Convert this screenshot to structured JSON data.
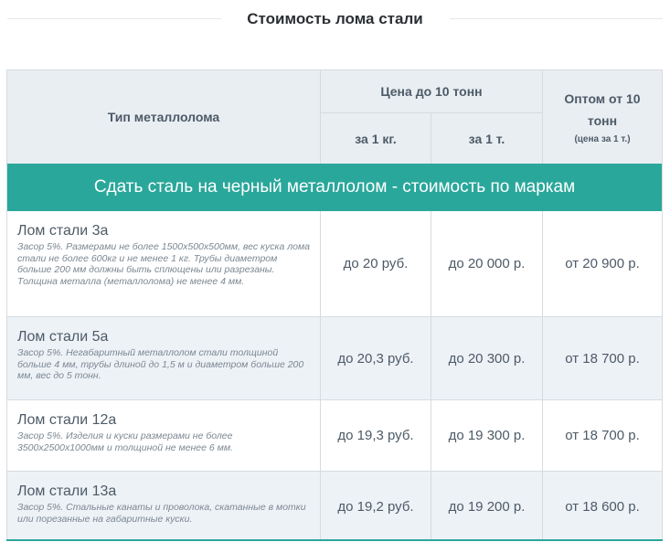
{
  "section": {
    "title": "Стоимость лома стали"
  },
  "table": {
    "header": {
      "type_label": "Тип металлолома",
      "price_group_label": "Цена до 10 тонн",
      "per_kg_label": "за 1 кг.",
      "per_ton_label": "за 1 т.",
      "wholesale_label": "Оптом от 10 тонн",
      "wholesale_sub": "(цена за 1 т.)"
    },
    "banner": "Сдать сталь на черный металлолом - стоимость по маркам",
    "rows": [
      {
        "name": "Лом стали 3а",
        "desc": "Засор 5%. Размерами не более 1500х500х500мм, вес куска лома стали не более 600кг и не менее 1 кг. Трубы диаметром больше 200 мм должны быть сплющены или разрезаны. Толщина металла (металлолома) не менее 4 мм.",
        "per_kg": "до 20 руб.",
        "per_ton": "до 20 000 р.",
        "wholesale": "от 20 900 р."
      },
      {
        "name": "Лом стали 5а",
        "desc": "Засор 5%. Негабаритный металлолом стали толщиной больше 4 мм, трубы длиной до 1,5 м и диаметром больше 200 мм, вес до 5 тонн.",
        "per_kg": "до 20,3 руб.",
        "per_ton": "до 20 300 р.",
        "wholesale": "от 18 700 р."
      },
      {
        "name": "Лом стали 12а",
        "desc": "Засор 5%. Изделия и куски размерами не более 3500х2500х1000мм и толщиной не менее 6 мм.",
        "per_kg": "до 19,3 руб.",
        "per_ton": "до 19 300 р.",
        "wholesale": "от 18 700 р."
      },
      {
        "name": "Лом стали 13а",
        "desc": "Засор 5%. Стальные канаты и проволока, скатанные в мотки или порезанные на габаритные куски.",
        "per_kg": "до 19,2 руб.",
        "per_ton": "до 19 200 р.",
        "wholesale": "от 18 600 р."
      }
    ]
  },
  "colors": {
    "accent": "#2aa79b",
    "header_bg": "#e9eef3",
    "alt_row_bg": "#edf2f7"
  }
}
